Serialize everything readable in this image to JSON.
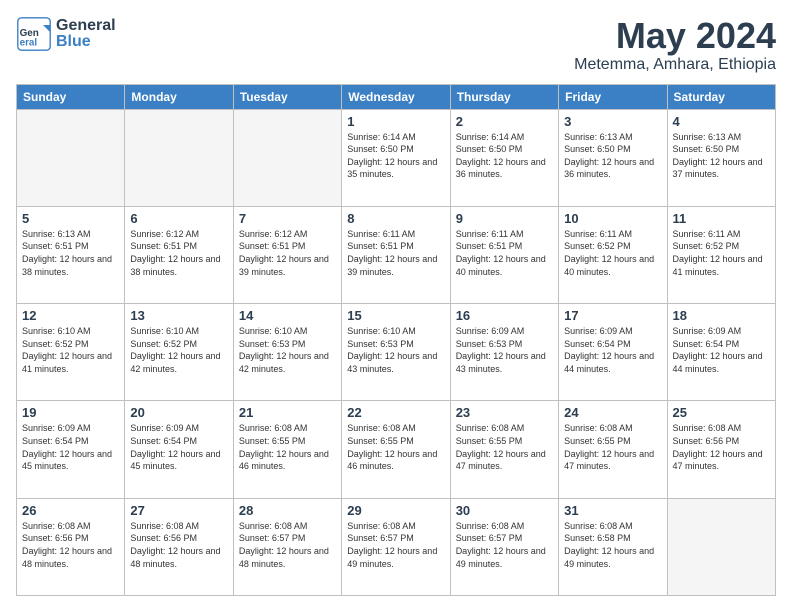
{
  "header": {
    "logo_general": "General",
    "logo_blue": "Blue",
    "month_title": "May 2024",
    "location": "Metemma, Amhara, Ethiopia"
  },
  "weekdays": [
    "Sunday",
    "Monday",
    "Tuesday",
    "Wednesday",
    "Thursday",
    "Friday",
    "Saturday"
  ],
  "weeks": [
    [
      {
        "day": "",
        "sunrise": "",
        "sunset": "",
        "daylight": ""
      },
      {
        "day": "",
        "sunrise": "",
        "sunset": "",
        "daylight": ""
      },
      {
        "day": "",
        "sunrise": "",
        "sunset": "",
        "daylight": ""
      },
      {
        "day": "1",
        "sunrise": "Sunrise: 6:14 AM",
        "sunset": "Sunset: 6:50 PM",
        "daylight": "Daylight: 12 hours and 35 minutes."
      },
      {
        "day": "2",
        "sunrise": "Sunrise: 6:14 AM",
        "sunset": "Sunset: 6:50 PM",
        "daylight": "Daylight: 12 hours and 36 minutes."
      },
      {
        "day": "3",
        "sunrise": "Sunrise: 6:13 AM",
        "sunset": "Sunset: 6:50 PM",
        "daylight": "Daylight: 12 hours and 36 minutes."
      },
      {
        "day": "4",
        "sunrise": "Sunrise: 6:13 AM",
        "sunset": "Sunset: 6:50 PM",
        "daylight": "Daylight: 12 hours and 37 minutes."
      }
    ],
    [
      {
        "day": "5",
        "sunrise": "Sunrise: 6:13 AM",
        "sunset": "Sunset: 6:51 PM",
        "daylight": "Daylight: 12 hours and 38 minutes."
      },
      {
        "day": "6",
        "sunrise": "Sunrise: 6:12 AM",
        "sunset": "Sunset: 6:51 PM",
        "daylight": "Daylight: 12 hours and 38 minutes."
      },
      {
        "day": "7",
        "sunrise": "Sunrise: 6:12 AM",
        "sunset": "Sunset: 6:51 PM",
        "daylight": "Daylight: 12 hours and 39 minutes."
      },
      {
        "day": "8",
        "sunrise": "Sunrise: 6:11 AM",
        "sunset": "Sunset: 6:51 PM",
        "daylight": "Daylight: 12 hours and 39 minutes."
      },
      {
        "day": "9",
        "sunrise": "Sunrise: 6:11 AM",
        "sunset": "Sunset: 6:51 PM",
        "daylight": "Daylight: 12 hours and 40 minutes."
      },
      {
        "day": "10",
        "sunrise": "Sunrise: 6:11 AM",
        "sunset": "Sunset: 6:52 PM",
        "daylight": "Daylight: 12 hours and 40 minutes."
      },
      {
        "day": "11",
        "sunrise": "Sunrise: 6:11 AM",
        "sunset": "Sunset: 6:52 PM",
        "daylight": "Daylight: 12 hours and 41 minutes."
      }
    ],
    [
      {
        "day": "12",
        "sunrise": "Sunrise: 6:10 AM",
        "sunset": "Sunset: 6:52 PM",
        "daylight": "Daylight: 12 hours and 41 minutes."
      },
      {
        "day": "13",
        "sunrise": "Sunrise: 6:10 AM",
        "sunset": "Sunset: 6:52 PM",
        "daylight": "Daylight: 12 hours and 42 minutes."
      },
      {
        "day": "14",
        "sunrise": "Sunrise: 6:10 AM",
        "sunset": "Sunset: 6:53 PM",
        "daylight": "Daylight: 12 hours and 42 minutes."
      },
      {
        "day": "15",
        "sunrise": "Sunrise: 6:10 AM",
        "sunset": "Sunset: 6:53 PM",
        "daylight": "Daylight: 12 hours and 43 minutes."
      },
      {
        "day": "16",
        "sunrise": "Sunrise: 6:09 AM",
        "sunset": "Sunset: 6:53 PM",
        "daylight": "Daylight: 12 hours and 43 minutes."
      },
      {
        "day": "17",
        "sunrise": "Sunrise: 6:09 AM",
        "sunset": "Sunset: 6:54 PM",
        "daylight": "Daylight: 12 hours and 44 minutes."
      },
      {
        "day": "18",
        "sunrise": "Sunrise: 6:09 AM",
        "sunset": "Sunset: 6:54 PM",
        "daylight": "Daylight: 12 hours and 44 minutes."
      }
    ],
    [
      {
        "day": "19",
        "sunrise": "Sunrise: 6:09 AM",
        "sunset": "Sunset: 6:54 PM",
        "daylight": "Daylight: 12 hours and 45 minutes."
      },
      {
        "day": "20",
        "sunrise": "Sunrise: 6:09 AM",
        "sunset": "Sunset: 6:54 PM",
        "daylight": "Daylight: 12 hours and 45 minutes."
      },
      {
        "day": "21",
        "sunrise": "Sunrise: 6:08 AM",
        "sunset": "Sunset: 6:55 PM",
        "daylight": "Daylight: 12 hours and 46 minutes."
      },
      {
        "day": "22",
        "sunrise": "Sunrise: 6:08 AM",
        "sunset": "Sunset: 6:55 PM",
        "daylight": "Daylight: 12 hours and 46 minutes."
      },
      {
        "day": "23",
        "sunrise": "Sunrise: 6:08 AM",
        "sunset": "Sunset: 6:55 PM",
        "daylight": "Daylight: 12 hours and 47 minutes."
      },
      {
        "day": "24",
        "sunrise": "Sunrise: 6:08 AM",
        "sunset": "Sunset: 6:55 PM",
        "daylight": "Daylight: 12 hours and 47 minutes."
      },
      {
        "day": "25",
        "sunrise": "Sunrise: 6:08 AM",
        "sunset": "Sunset: 6:56 PM",
        "daylight": "Daylight: 12 hours and 47 minutes."
      }
    ],
    [
      {
        "day": "26",
        "sunrise": "Sunrise: 6:08 AM",
        "sunset": "Sunset: 6:56 PM",
        "daylight": "Daylight: 12 hours and 48 minutes."
      },
      {
        "day": "27",
        "sunrise": "Sunrise: 6:08 AM",
        "sunset": "Sunset: 6:56 PM",
        "daylight": "Daylight: 12 hours and 48 minutes."
      },
      {
        "day": "28",
        "sunrise": "Sunrise: 6:08 AM",
        "sunset": "Sunset: 6:57 PM",
        "daylight": "Daylight: 12 hours and 48 minutes."
      },
      {
        "day": "29",
        "sunrise": "Sunrise: 6:08 AM",
        "sunset": "Sunset: 6:57 PM",
        "daylight": "Daylight: 12 hours and 49 minutes."
      },
      {
        "day": "30",
        "sunrise": "Sunrise: 6:08 AM",
        "sunset": "Sunset: 6:57 PM",
        "daylight": "Daylight: 12 hours and 49 minutes."
      },
      {
        "day": "31",
        "sunrise": "Sunrise: 6:08 AM",
        "sunset": "Sunset: 6:58 PM",
        "daylight": "Daylight: 12 hours and 49 minutes."
      },
      {
        "day": "",
        "sunrise": "",
        "sunset": "",
        "daylight": ""
      }
    ]
  ]
}
